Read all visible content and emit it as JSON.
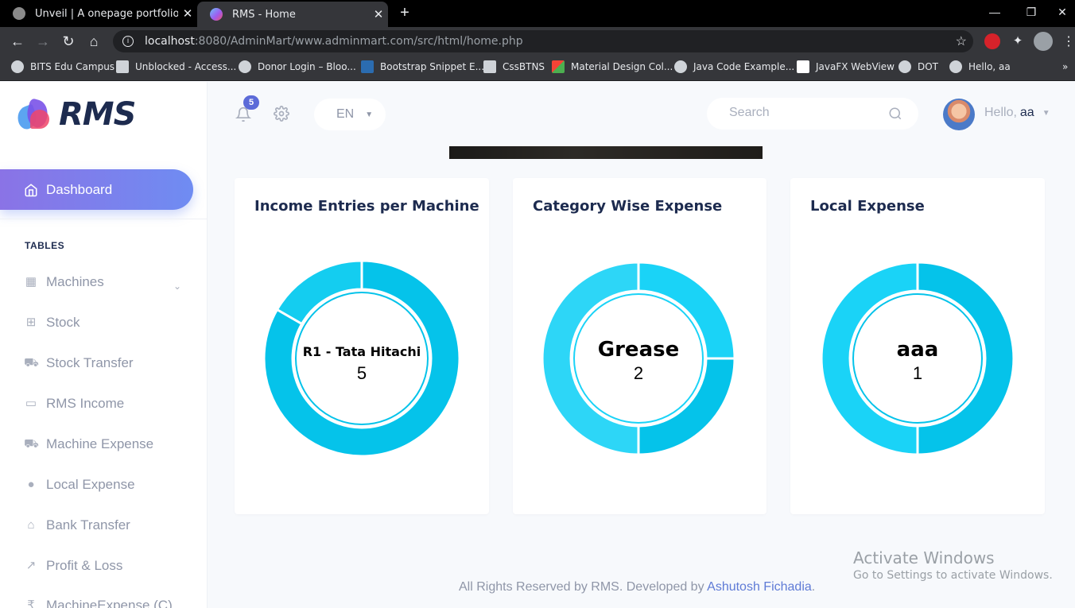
{
  "browser": {
    "tabs": [
      {
        "title": "Unveil | A onepage portfolio",
        "active": false
      },
      {
        "title": "RMS - Home",
        "active": true
      }
    ],
    "url_host": "localhost",
    "url_rest": ":8080/AdminMart/www.adminmart.com/src/html/home.php",
    "bookmarks": [
      "BITS Edu Campus",
      "Unblocked - Access...",
      "Donor Login – Bloo...",
      "Bootstrap Snippet E...",
      "CssBTNS",
      "Material Design Col...",
      "Java Code Example...",
      "JavaFX WebView",
      "DOT",
      "Hello, aa"
    ]
  },
  "sidebar": {
    "logo": "RMS",
    "dashboard_label": "Dashboard",
    "section_heading": "TABLES",
    "items": [
      {
        "label": "Machines",
        "icon": "grid-icon"
      },
      {
        "label": "Stock",
        "icon": "sitemap-icon"
      },
      {
        "label": "Stock Transfer",
        "icon": "truck-loading-icon"
      },
      {
        "label": "RMS Income",
        "icon": "folder-icon"
      },
      {
        "label": "Machine Expense",
        "icon": "truck-icon"
      },
      {
        "label": "Local Expense",
        "icon": "user-icon"
      },
      {
        "label": "Bank Transfer",
        "icon": "bank-icon"
      },
      {
        "label": "Profit & Loss",
        "icon": "chart-line-icon"
      },
      {
        "label": "MachineExpense (C)",
        "icon": "rupee-icon"
      }
    ]
  },
  "topbar": {
    "notification_count": "5",
    "language": "EN",
    "search_placeholder": "Search",
    "greeting": "Hello,",
    "username": "aa"
  },
  "cards": [
    {
      "title": "Income Entries per Machine",
      "center_label": "R1 - Tata Hitachi",
      "center_value": "5"
    },
    {
      "title": "Category Wise Expense",
      "center_label": "Grease",
      "center_value": "2"
    },
    {
      "title": "Local Expense",
      "center_label": "aaa",
      "center_value": "1"
    }
  ],
  "chart_data": [
    {
      "type": "pie",
      "title": "Income Entries per Machine",
      "categories": [
        "R1 - Tata Hitachi",
        ""
      ],
      "values": [
        5,
        1
      ],
      "colors": [
        "#05c3ea",
        "#14cdf0"
      ]
    },
    {
      "type": "pie",
      "title": "Category Wise Expense",
      "categories": [
        "",
        "Grease",
        ""
      ],
      "values": [
        1,
        1,
        2
      ],
      "colors": [
        "#1ad3f7",
        "#05c3ea",
        "#2dd6f7"
      ]
    },
    {
      "type": "pie",
      "title": "Local Expense",
      "categories": [
        "aaa",
        ""
      ],
      "values": [
        1,
        1
      ],
      "colors": [
        "#05c3ea",
        "#1ad3f7"
      ]
    }
  ],
  "footer": {
    "text": "All Rights Reserved by RMS. Developed by",
    "author": "Ashutosh Fichadia",
    "end": "."
  },
  "watermark": {
    "line1": "Activate Windows",
    "line2": "Go to Settings to activate Windows."
  }
}
